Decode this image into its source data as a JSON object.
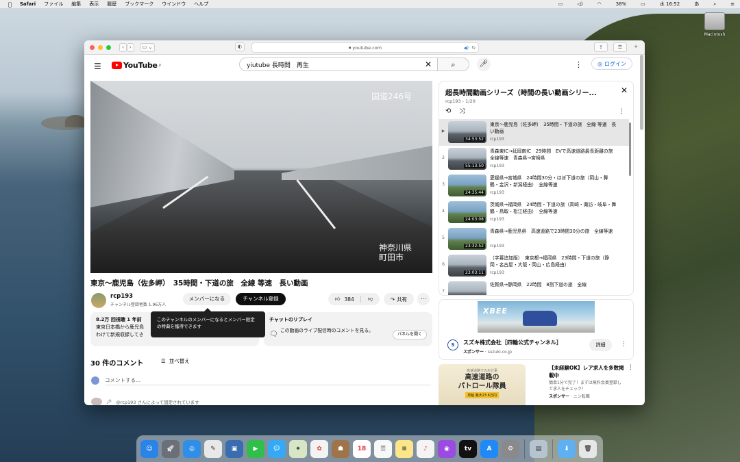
{
  "menubar": {
    "apple": "",
    "app": "Safari",
    "items": [
      "ファイル",
      "編集",
      "表示",
      "履歴",
      "ブックマーク",
      "ウインドウ",
      "ヘルプ"
    ],
    "battery": "38%",
    "clock": "水 16:52"
  },
  "desktop": {
    "drive_label": "Macintosh"
  },
  "browser": {
    "url": "youtube.com",
    "toolbar": {
      "back": "‹",
      "forward": "›",
      "sidebar": "▭ ⌄",
      "share": "⇪",
      "tabs": "☰",
      "newtab": "+"
    }
  },
  "youtube": {
    "logo": "YouTube",
    "logo_region": "JP",
    "search_value": "yiutube 長時間　再生",
    "login": "ログイン",
    "video": {
      "overlay_top": "国道246号",
      "overlay_bottom_1": "神奈川県",
      "overlay_bottom_2": "町田市",
      "title": "東京〜鹿児島（佐多岬）　35時間・下道の旅　全線 等速　長い動画",
      "channel": "rcp193",
      "subscribers": "チャンネル登録者数 1.96万人",
      "member_btn": "メンバーになる",
      "subscribe_btn": "チャンネル登録",
      "likes": "384",
      "share": "共有"
    },
    "description": {
      "line1": "8.2万 回視聴  1 年前",
      "line2": "東京日本橋から鹿児島",
      "line3": "わけて新規収録してき"
    },
    "replay": {
      "title": "チャットのリプレイ",
      "text": "この動画のライブ配信時のコメントを見る。",
      "panel_btn": "パネルを開く"
    },
    "tooltip": "このチャンネルのメンバーになるとメンバー限定の特典を獲得できます",
    "comments": {
      "count": "30 件のコメント",
      "sort": "並べ替え",
      "placeholder": "コメントする...",
      "pinned": "@rcp193 さんによって固定されています"
    },
    "playlist": {
      "title": "超長時間動画シリーズ（時間の長い動画シリー...",
      "sub": "rcp193 - 1/20",
      "items": [
        {
          "num": "▶",
          "title": "東京〜鹿児島（佐多岬）　35時間・下道の旅　全線 等速　長い動画",
          "channel": "rcp193",
          "duration": "34:53:52"
        },
        {
          "num": "2",
          "title": "青森東IC→延岡南IC　29時間　EVで高速道路最長距離の旅　全線等速　青森県→宮崎県",
          "channel": "rcp193",
          "duration": "55:13:50"
        },
        {
          "num": "3",
          "title": "愛媛県→宮城県　24時間30分・ほぼ下道の旅（岡山・舞鶴・金沢・新潟経由）　全線等速",
          "channel": "rcp193",
          "duration": "24:35:44"
        },
        {
          "num": "4",
          "title": "茨城県→福岡県　24時間・下道の旅（高崎・諏訪・岐阜・舞鶴・鳥取・松江経由）　全線等速",
          "channel": "rcp193",
          "duration": "24:03:08"
        },
        {
          "num": "5",
          "title": "青森県→鹿児島県　高速道路で23時間30分の旅　全線等速",
          "channel": "rcp193",
          "duration": "23:32:52"
        },
        {
          "num": "6",
          "title": "（字幕追加版）　東京都→福岡県　23時間・下道の旅（静岡・名古屋・大阪・岡山・広島経由）",
          "channel": "rcp193",
          "duration": "23:03:11"
        },
        {
          "num": "7",
          "title": "佐賀県→静岡県　22時間　8割下道の旅　全線",
          "channel": "rcp193",
          "duration": ""
        }
      ]
    },
    "ad": {
      "banner": "XBEE",
      "logo": "S",
      "title": "スズキ株式会社［四輪公式チャンネル］",
      "sponsor": "スポンサー",
      "domain": "suzuki.co.jp",
      "button": "詳細"
    },
    "ad2": {
      "thumb_small": "高速道路でのお仕事",
      "thumb_title_1": "高速道路の",
      "thumb_title_2": "パトロール隊員",
      "thumb_badge": "月給 最大23.6万円",
      "title": "【未経験OK】レア求人を多数掲載中",
      "desc": "簡単1分で完了！まずは無料会員登録して求人をチェック！",
      "sponsor": "スポンサー",
      "sponsor_name": "ニン転職"
    }
  }
}
